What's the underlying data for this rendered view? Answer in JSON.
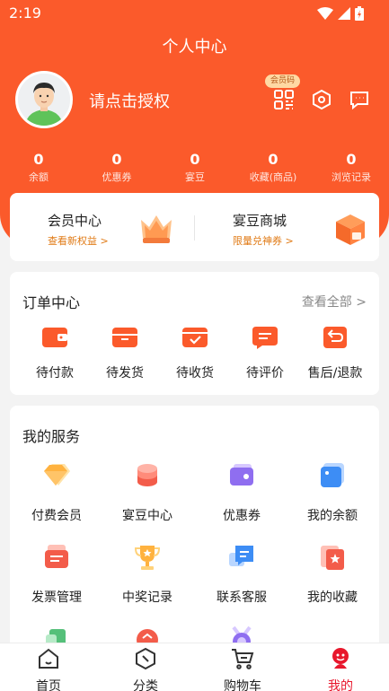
{
  "status_bar": {
    "time": "2:19"
  },
  "header": {
    "title": "个人中心",
    "login_prompt": "请点击授权",
    "member_code_badge": "会员码",
    "icons": [
      "qrcode-icon",
      "settings-icon",
      "message-icon"
    ]
  },
  "stats": [
    {
      "value": "0",
      "label": "余额"
    },
    {
      "value": "0",
      "label": "优惠券"
    },
    {
      "value": "0",
      "label": "宴豆"
    },
    {
      "value": "0",
      "label": "收藏(商品)"
    },
    {
      "value": "0",
      "label": "浏览记录"
    }
  ],
  "vip": {
    "member_center": {
      "title": "会员中心",
      "subtitle": "查看新权益 >"
    },
    "bean_mall": {
      "title": "宴豆商城",
      "subtitle": "限量兑神券 >"
    }
  },
  "orders": {
    "title": "订单中心",
    "view_all": "查看全部 >",
    "items": [
      {
        "label": "待付款",
        "icon": "wallet-icon"
      },
      {
        "label": "待发货",
        "icon": "box-icon"
      },
      {
        "label": "待收货",
        "icon": "received-icon"
      },
      {
        "label": "待评价",
        "icon": "comment-icon"
      },
      {
        "label": "售后/退款",
        "icon": "refund-icon"
      }
    ]
  },
  "services": {
    "title": "我的服务",
    "items": [
      {
        "label": "付费会员",
        "icon": "diamond-icon"
      },
      {
        "label": "宴豆中心",
        "icon": "coins-icon"
      },
      {
        "label": "优惠券",
        "icon": "coupon-icon"
      },
      {
        "label": "我的余额",
        "icon": "balance-icon"
      },
      {
        "label": "发票管理",
        "icon": "invoice-icon"
      },
      {
        "label": "中奖记录",
        "icon": "trophy-icon"
      },
      {
        "label": "联系客服",
        "icon": "chat-icon"
      },
      {
        "label": "我的收藏",
        "icon": "favorite-icon"
      }
    ]
  },
  "tabbar": [
    {
      "label": "首页",
      "icon": "home-icon"
    },
    {
      "label": "分类",
      "icon": "category-icon"
    },
    {
      "label": "购物车",
      "icon": "cart-icon"
    },
    {
      "label": "我的",
      "icon": "profile-icon",
      "active": true
    }
  ],
  "colors": {
    "brand": "#fb5a2b",
    "accent_red": "#e8172c",
    "gold": "#e07a15"
  }
}
